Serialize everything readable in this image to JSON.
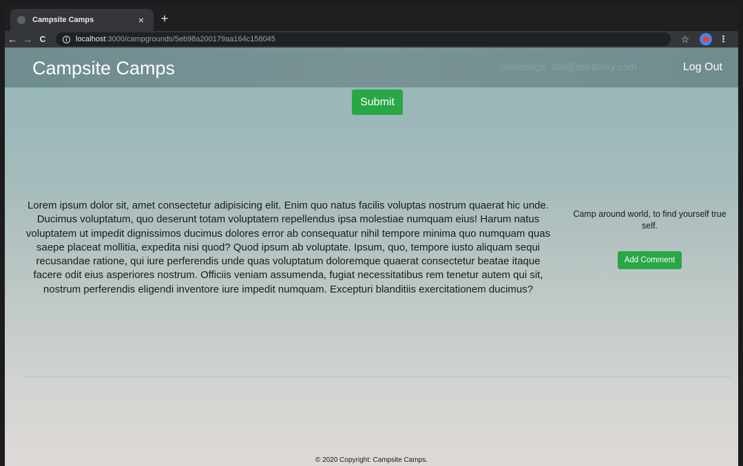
{
  "browser": {
    "tab_title": "Campsite Camps",
    "tab_close": "×",
    "new_tab": "+",
    "back": "←",
    "forward": "→",
    "reload": "C",
    "url_host": "localhost",
    "url_path": ":3000/campgrounds/5eb98a200179aa164c158045",
    "star": "☆",
    "menu": "⋮"
  },
  "navbar": {
    "brand": "Campsite Camps",
    "greeting": "Greetings, ats@asktbsky.com",
    "logout": "Log Out"
  },
  "form": {
    "submit_label": "Submit"
  },
  "campground": {
    "description": "Lorem ipsum dolor sit, amet consectetur adipisicing elit. Enim quo natus facilis voluptas nostrum quaerat hic unde. Ducimus voluptatum, quo deserunt totam voluptatem repellendus ipsa molestiae numquam eius! Harum natus voluptatem ut impedit dignissimos ducimus dolores error ab consequatur nihil tempore minima quo numquam quas saepe placeat mollitia, expedita nisi quod? Quod ipsum ab voluptate. Ipsum, quo, tempore iusto aliquam sequi recusandae ratione, qui iure perferendis unde quas voluptatum doloremque quaerat consectetur beatae itaque facere odit eius asperiores nostrum. Officiis veniam assumenda, fugiat necessitatibus rem tenetur autem qui sit, nostrum perferendis eligendi inventore iure impedit numquam. Excepturi blanditiis exercitationem ducimus?"
  },
  "comments": {
    "items": [
      "Camp around world, to find yourself true self."
    ],
    "add_label": "Add Comment"
  },
  "footer": {
    "text": "© 2020 Copyright: Campsite Camps."
  },
  "colors": {
    "accent_green": "#28a745",
    "navbar": "#728e90"
  }
}
